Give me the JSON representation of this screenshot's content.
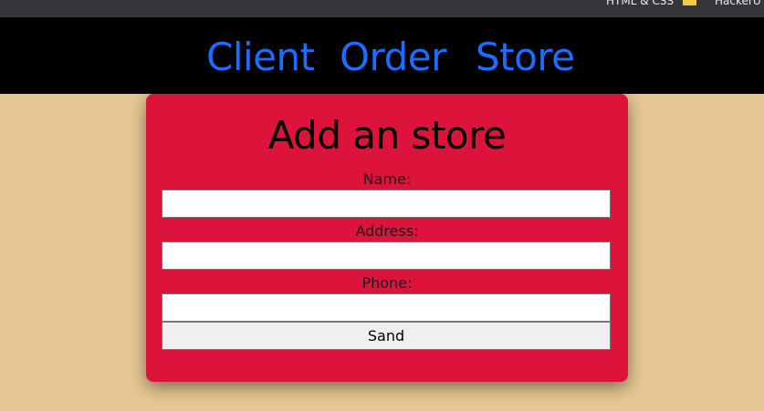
{
  "browser": {
    "bookmarks": [
      {
        "label": "HTML & CSS"
      },
      {
        "label": "HackerU"
      }
    ]
  },
  "nav": {
    "links": [
      {
        "label": "Client"
      },
      {
        "label": "Order"
      },
      {
        "label": "Store"
      }
    ]
  },
  "form": {
    "title": "Add an store",
    "fields": [
      {
        "label": "Name:",
        "value": ""
      },
      {
        "label": "Address:",
        "value": ""
      },
      {
        "label": "Phone:",
        "value": ""
      }
    ],
    "submit_label": "Sand"
  },
  "colors": {
    "page_background": "#e6c794",
    "nav_background": "#000000",
    "nav_link": "#1a6dff",
    "card_background": "#dc143c"
  }
}
